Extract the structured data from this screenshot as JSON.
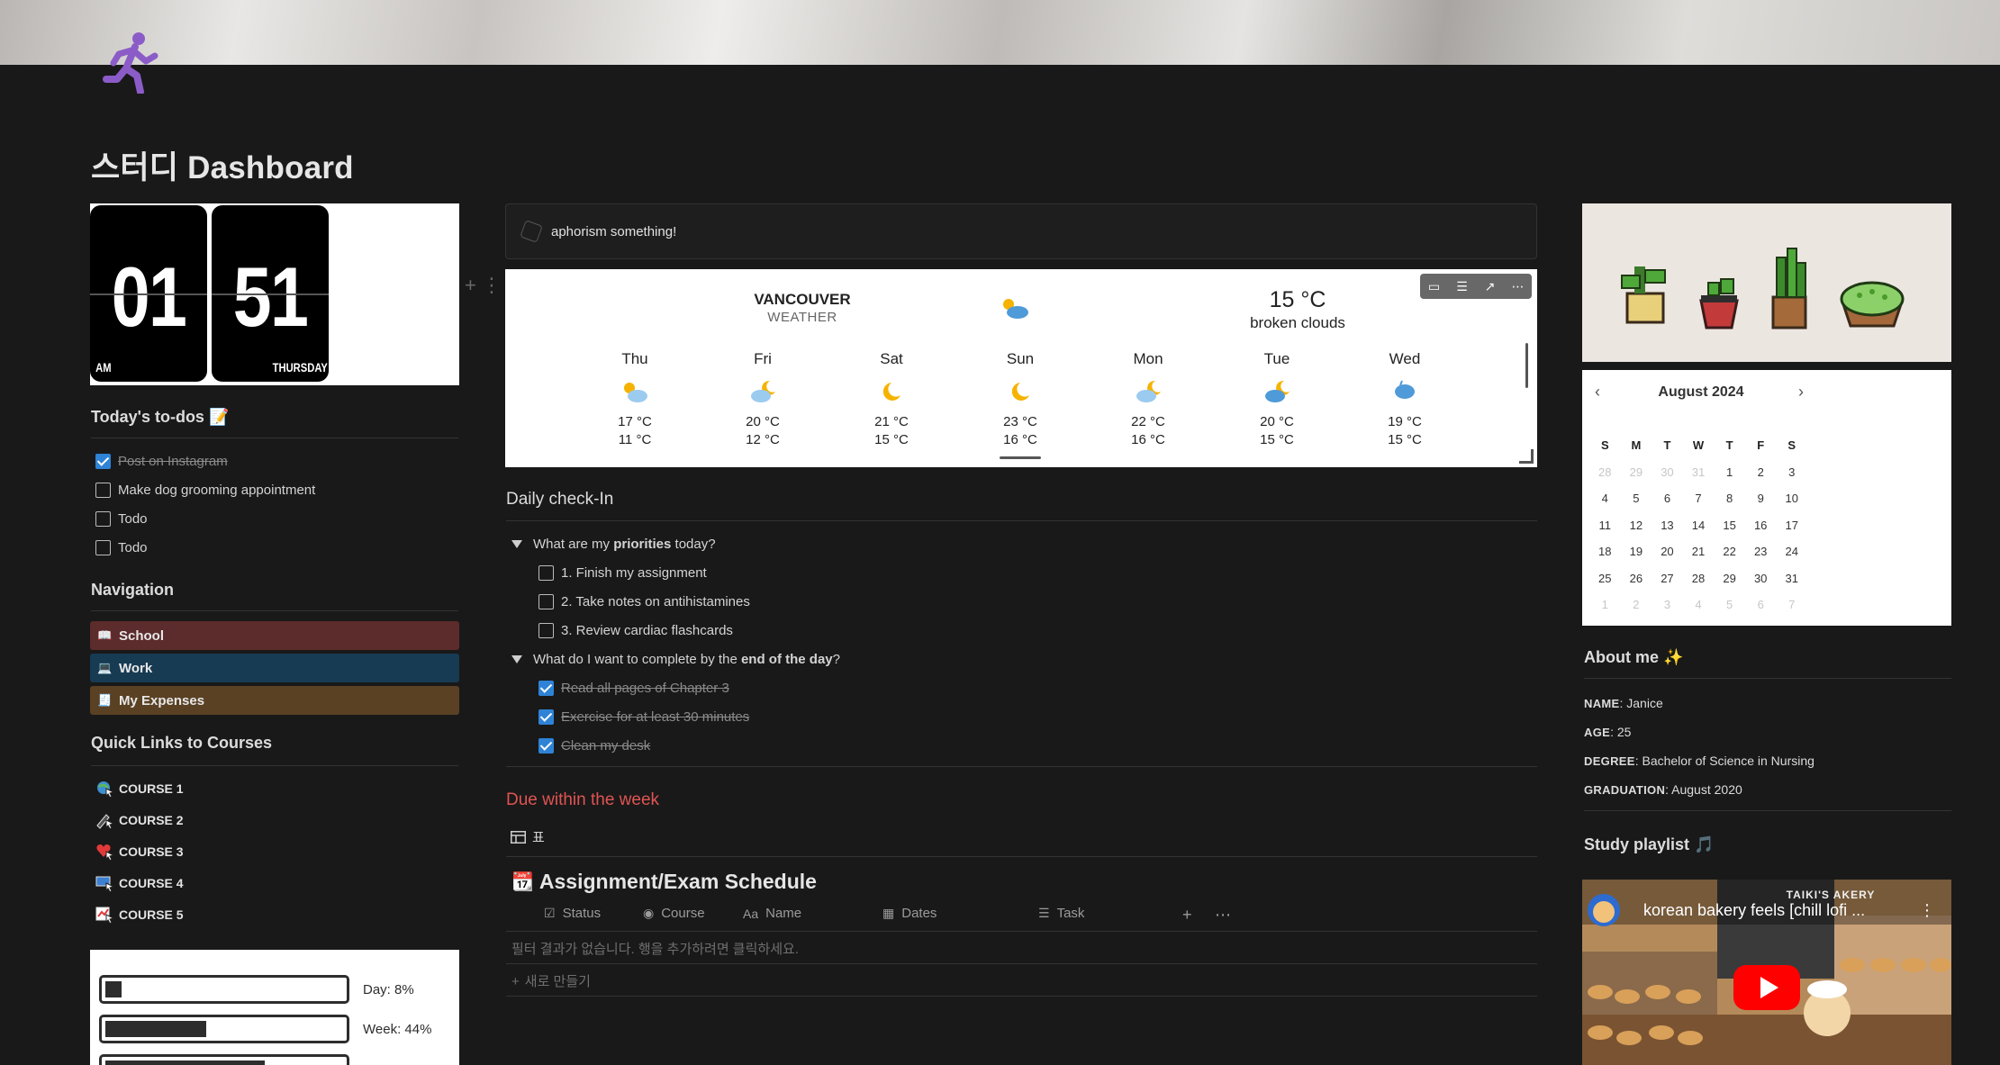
{
  "page": {
    "title": "스터디 Dashboard",
    "icon": "running-person-icon"
  },
  "clock": {
    "hour": "01",
    "minute": "51",
    "ampm": "AM",
    "weekday": "THURSDAY"
  },
  "todos": {
    "heading": "Today's to-dos 📝",
    "items": [
      {
        "label": "Post on Instagram",
        "checked": true
      },
      {
        "label": "Make dog grooming appointment",
        "checked": false
      },
      {
        "label": "Todo",
        "checked": false
      },
      {
        "label": "Todo",
        "checked": false
      }
    ]
  },
  "navigation": {
    "heading": "Navigation",
    "items": [
      {
        "label": "School",
        "icon": "book-icon",
        "color": "#5c2b2b"
      },
      {
        "label": "Work",
        "icon": "laptop-icon",
        "color": "#173b52"
      },
      {
        "label": "My Expenses",
        "icon": "receipt-icon",
        "color": "#5a4124"
      }
    ]
  },
  "courses": {
    "heading": "Quick Links to Courses",
    "items": [
      {
        "label": "COURSE 1",
        "icon": "globe-cursor-icon"
      },
      {
        "label": "COURSE 2",
        "icon": "pen-cursor-icon"
      },
      {
        "label": "COURSE 3",
        "icon": "heart-cursor-icon"
      },
      {
        "label": "COURSE 4",
        "icon": "monitor-cursor-icon"
      },
      {
        "label": "COURSE 5",
        "icon": "chart-cursor-icon"
      }
    ]
  },
  "progress": {
    "items": [
      {
        "label": "Day: 8%",
        "value": 0.08
      },
      {
        "label": "Week: 44%",
        "value": 0.44
      },
      {
        "label": "",
        "value": 0.68
      }
    ]
  },
  "quote": {
    "text": "aphorism something!"
  },
  "weather": {
    "city": "VANCOUVER",
    "subtitle": "WEATHER",
    "current_temp": "15 °C",
    "current_desc": "broken clouds",
    "current_icon": "sun-cloud-icon",
    "days": [
      {
        "day": "Thu",
        "high": "17 °C",
        "low": "11 °C",
        "icon": "sun-cloud-icon"
      },
      {
        "day": "Fri",
        "high": "20 °C",
        "low": "12 °C",
        "icon": "moon-cloud-icon"
      },
      {
        "day": "Sat",
        "high": "21 °C",
        "low": "15 °C",
        "icon": "moon-icon"
      },
      {
        "day": "Sun",
        "high": "23 °C",
        "low": "16 °C",
        "icon": "moon-icon"
      },
      {
        "day": "Mon",
        "high": "22 °C",
        "low": "16 °C",
        "icon": "moon-cloud-icon"
      },
      {
        "day": "Tue",
        "high": "20 °C",
        "low": "15 °C",
        "icon": "moon-cloud-icon"
      },
      {
        "day": "Wed",
        "high": "19 °C",
        "low": "15 °C",
        "icon": "cloud-rain-icon"
      }
    ]
  },
  "checkin": {
    "heading": "Daily check-In",
    "q1_pre": "What are my ",
    "q1_bold": "priorities",
    "q1_post": " today?",
    "q1_items": [
      {
        "label": "1. Finish my assignment",
        "checked": false
      },
      {
        "label": "2. Take notes on antihistamines",
        "checked": false
      },
      {
        "label": "3. Review cardiac flashcards",
        "checked": false
      }
    ],
    "q2_pre": "What do I want to complete by the ",
    "q2_bold": "end of the day",
    "q2_post": "?",
    "q2_items": [
      {
        "label": "Read all pages of Chapter 3",
        "checked": true
      },
      {
        "label": "Exercise for at least 30 minutes",
        "checked": true
      },
      {
        "label": "Clean my desk",
        "checked": true
      }
    ]
  },
  "due": {
    "heading": "Due within the week",
    "view_label": "표",
    "db_title": "Assignment/Exam Schedule",
    "columns": [
      {
        "label": "Status",
        "icon": "checkbox-icon"
      },
      {
        "label": "Course",
        "icon": "status-icon"
      },
      {
        "label": "Name",
        "icon": "text-icon"
      },
      {
        "label": "Dates",
        "icon": "calendar-icon"
      },
      {
        "label": "Task",
        "icon": "list-icon"
      }
    ],
    "empty_message": "필터 결과가 없습니다. 행을 추가하려면 클릭하세요.",
    "new_label": "새로 만들기"
  },
  "calendar": {
    "month_label": "August 2024",
    "weekdays": [
      "S",
      "M",
      "T",
      "W",
      "T",
      "F",
      "S"
    ],
    "weeks": [
      [
        "28",
        "29",
        "30",
        "31",
        "1",
        "2",
        "3"
      ],
      [
        "4",
        "5",
        "6",
        "7",
        "8",
        "9",
        "10"
      ],
      [
        "11",
        "12",
        "13",
        "14",
        "15",
        "16",
        "17"
      ],
      [
        "18",
        "19",
        "20",
        "21",
        "22",
        "23",
        "24"
      ],
      [
        "25",
        "26",
        "27",
        "28",
        "29",
        "30",
        "31"
      ],
      [
        "1",
        "2",
        "3",
        "4",
        "5",
        "6",
        "7"
      ]
    ],
    "muted": [
      [
        0,
        0
      ],
      [
        0,
        1
      ],
      [
        0,
        2
      ],
      [
        0,
        3
      ],
      [
        5,
        0
      ],
      [
        5,
        1
      ],
      [
        5,
        2
      ],
      [
        5,
        3
      ],
      [
        5,
        4
      ],
      [
        5,
        5
      ],
      [
        5,
        6
      ]
    ]
  },
  "about": {
    "heading": "About me ✨",
    "lines": [
      {
        "key": "NAME",
        "value": ": Janice"
      },
      {
        "key": "AGE",
        "value": ": 25"
      },
      {
        "key": "DEGREE",
        "value": ": Bachelor of Science in Nursing"
      },
      {
        "key": "GRADUATION",
        "value": ": August 2020"
      }
    ]
  },
  "playlist": {
    "heading": "Study playlist 🎵",
    "video_title": "korean bakery feels [chill lofi ...",
    "shop_sign": "TAIKI'S  AKERY"
  }
}
